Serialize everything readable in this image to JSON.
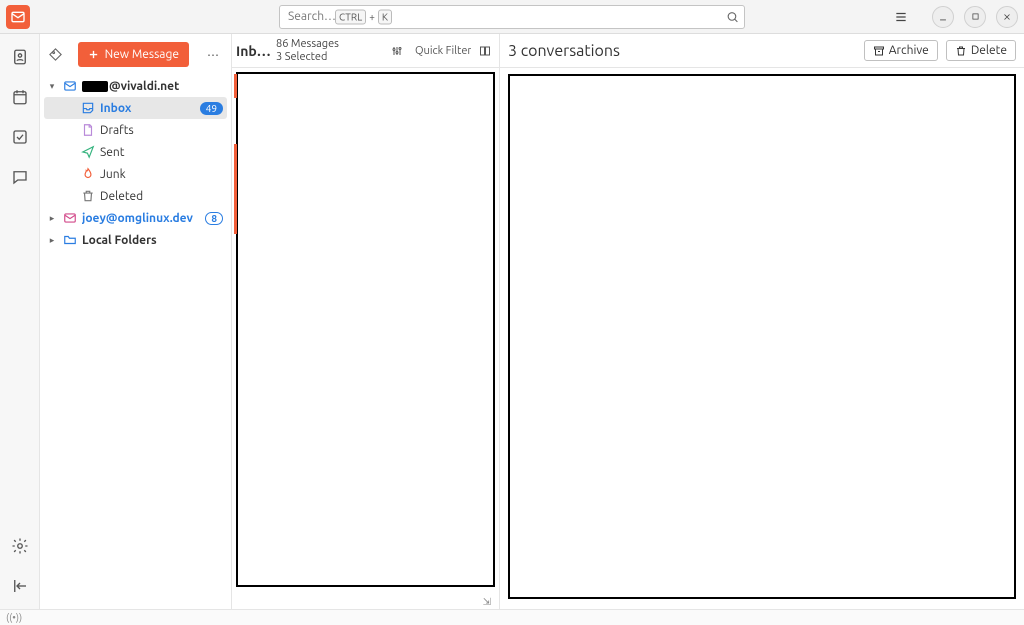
{
  "titlebar": {
    "search_placeholder": "Search…",
    "shortcut_parts": [
      "CTRL",
      "+",
      "K"
    ]
  },
  "sidebar": {
    "new_message_label": "New Message",
    "accounts": [
      {
        "label_suffix": "@vivaldi.net",
        "expanded": true,
        "folders": [
          {
            "id": "inbox",
            "label": "Inbox",
            "icon": "inbox",
            "badge": "49",
            "selected": true
          },
          {
            "id": "drafts",
            "label": "Drafts",
            "icon": "drafts"
          },
          {
            "id": "sent",
            "label": "Sent",
            "icon": "sent"
          },
          {
            "id": "junk",
            "label": "Junk",
            "icon": "junk"
          },
          {
            "id": "deleted",
            "label": "Deleted",
            "icon": "trash"
          }
        ]
      },
      {
        "label": "joey@omglinux.dev",
        "expanded": false,
        "badge": "8",
        "blue": true
      },
      {
        "label": "Local Folders",
        "expanded": false
      }
    ]
  },
  "message_list": {
    "title": "Inbox",
    "count_line1": "86 Messages",
    "count_line2": "3 Selected",
    "quick_filter_label": "Quick Filter"
  },
  "reading": {
    "header": "3 conversations",
    "archive_label": "Archive",
    "delete_label": "Delete"
  }
}
